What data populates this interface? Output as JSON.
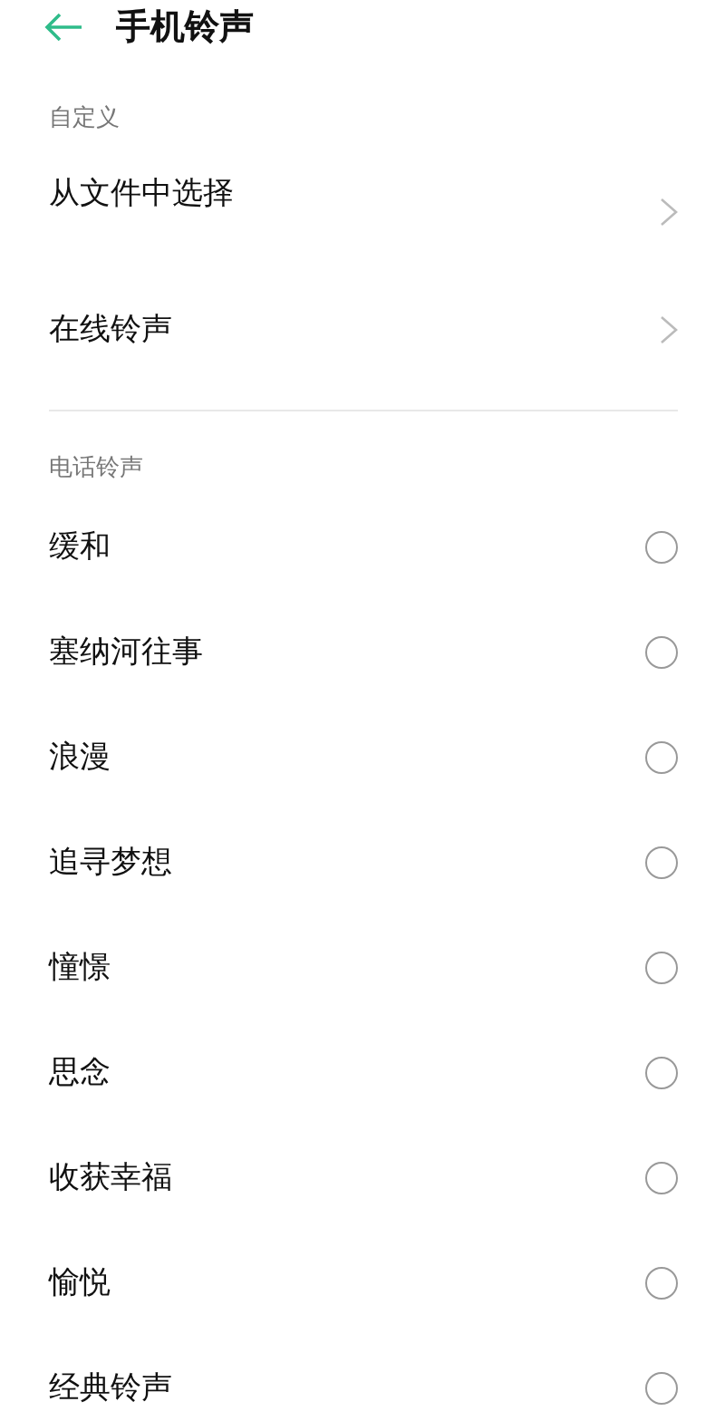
{
  "header": {
    "title": "手机铃声"
  },
  "sections": [
    {
      "label": "自定义",
      "items": [
        {
          "kind": "link",
          "label": "从文件中选择"
        },
        {
          "kind": "link",
          "label": "在线铃声"
        }
      ]
    },
    {
      "label": "电话铃声",
      "items": [
        {
          "kind": "radio",
          "label": "缓和",
          "selected": false
        },
        {
          "kind": "radio",
          "label": "塞纳河往事",
          "selected": false
        },
        {
          "kind": "radio",
          "label": "浪漫",
          "selected": false
        },
        {
          "kind": "radio",
          "label": "追寻梦想",
          "selected": false
        },
        {
          "kind": "radio",
          "label": "憧憬",
          "selected": false
        },
        {
          "kind": "radio",
          "label": "思念",
          "selected": false
        },
        {
          "kind": "radio",
          "label": "收获幸福",
          "selected": false
        },
        {
          "kind": "radio",
          "label": "愉悦",
          "selected": false
        },
        {
          "kind": "radio",
          "label": "经典铃声",
          "selected": false
        }
      ]
    }
  ]
}
